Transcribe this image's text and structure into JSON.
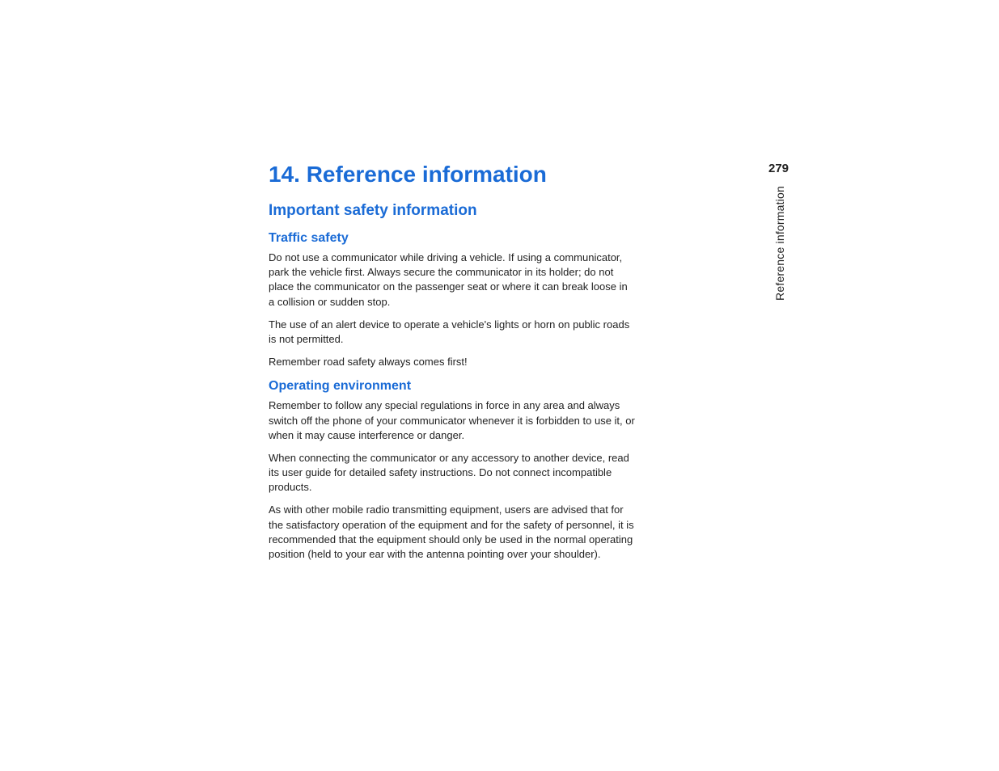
{
  "page_number": "279",
  "side_label": "Reference information",
  "chapter_title": "14. Reference information",
  "section_title": "Important safety information",
  "subsections": [
    {
      "title": "Traffic safety",
      "paragraphs": [
        "Do not use a communicator while driving a vehicle. If using a communicator, park the vehicle first. Always secure the communicator in its holder; do not place the communicator on the passenger seat or where it can break loose in a collision or sudden stop.",
        "The use of an alert device to operate a vehicle's lights or horn on public roads is not permitted.",
        "Remember road safety always comes first!"
      ]
    },
    {
      "title": "Operating environment",
      "paragraphs": [
        "Remember to follow any special regulations in force in any area and always switch off the phone of your communicator whenever it is forbidden to use it, or when it may cause interference or danger.",
        "When connecting the communicator or any accessory to another device, read its user guide for detailed safety instructions. Do not connect incompatible products.",
        "As with other mobile radio transmitting equipment, users are advised that for the satisfactory operation of the equipment and for the safety of personnel, it is recommended that the equipment should only be used in the normal operating position (held to your ear with the antenna pointing over your shoulder)."
      ]
    }
  ]
}
